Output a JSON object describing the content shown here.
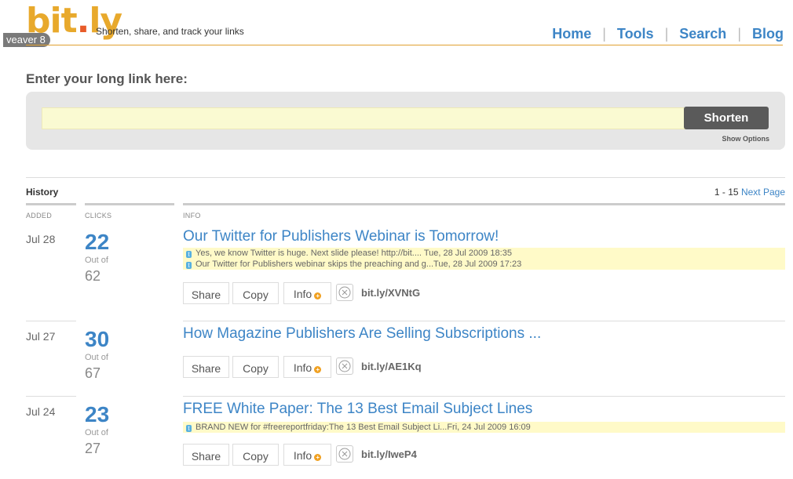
{
  "header": {
    "logo": "bit.ly",
    "badge": "veaver 8",
    "tagline": "Shorten, share, and track your links",
    "nav": [
      "Home",
      "Tools",
      "Search",
      "Blog"
    ]
  },
  "shorten": {
    "label": "Enter your long link here:",
    "input_value": "",
    "button": "Shorten",
    "options": "Show Options"
  },
  "history": {
    "title": "History",
    "range": "1 - 15",
    "next": "Next Page",
    "columns": [
      "ADDED",
      "CLICKS",
      "INFO"
    ],
    "rows": [
      {
        "date": "Jul 28",
        "clicks": "22",
        "out_of": "Out of",
        "total": "62",
        "title": "Our Twitter for Publishers Webinar is Tomorrow!",
        "tweets": [
          "Yes, we know Twitter is huge. Next slide please! http://bit.... Tue, 28 Jul 2009 18:35",
          "Our Twitter for Publishers webinar skips the preaching and g...Tue, 28 Jul 2009 17:23"
        ],
        "share": "Share",
        "copy": "Copy",
        "info": "Info",
        "short_url": "bit.ly/XVNtG"
      },
      {
        "date": "Jul 27",
        "clicks": "30",
        "out_of": "Out of",
        "total": "67",
        "title": "How Magazine Publishers Are Selling Subscriptions ...",
        "tweets": [],
        "share": "Share",
        "copy": "Copy",
        "info": "Info",
        "short_url": "bit.ly/AE1Kq"
      },
      {
        "date": "Jul 24",
        "clicks": "23",
        "out_of": "Out of",
        "total": "27",
        "title": "FREE White Paper: The 13 Best Email Subject Lines",
        "tweets": [
          "BRAND NEW for #freereportfriday:The 13 Best Email Subject Li...Fri, 24 Jul 2009 16:09"
        ],
        "share": "Share",
        "copy": "Copy",
        "info": "Info",
        "short_url": "bit.ly/IweP4"
      }
    ]
  }
}
